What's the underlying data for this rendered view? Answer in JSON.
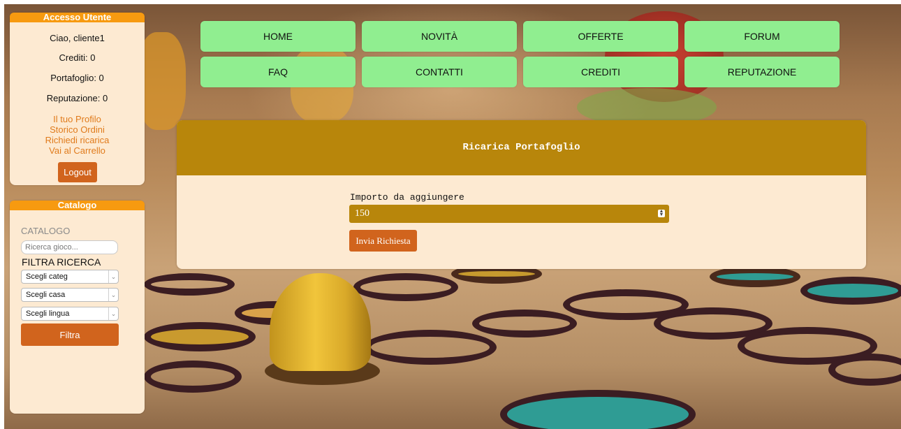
{
  "user_panel": {
    "header": "Accesso Utente",
    "greeting": "Ciao, cliente1",
    "credits": "Crediti: 0",
    "wallet": "Portafoglio: 0",
    "reputation": "Reputazione: 0",
    "links": [
      "Il tuo Profilo",
      "Storico Ordini",
      "Richiedi ricarica",
      "Vai al Carrello"
    ],
    "logout_label": "Logout"
  },
  "catalog_panel": {
    "header": "Catalogo",
    "label": "CATALOGO",
    "search_placeholder": "Ricerca gioco...",
    "filter_title": "FILTRA RICERCA",
    "selects": [
      "Scegli categ",
      "Scegli casa",
      "Scegli lingua"
    ],
    "filter_button": "Filtra"
  },
  "nav": {
    "items": [
      "HOME",
      "NOVITÀ",
      "OFFERTE",
      "FORUM",
      "FAQ",
      "CONTATTI",
      "CREDITI",
      "REPUTAZIONE"
    ]
  },
  "main": {
    "title": "Ricarica Portafoglio",
    "field_label": "Importo da aggiungere",
    "amount_value": "150",
    "submit_label": "Invia Richiesta"
  },
  "colors": {
    "accent_orange": "#f79a10",
    "button_orange": "#d1641d",
    "nav_green": "#90ee90",
    "card_gold": "#b8860b",
    "panel_bg": "#fdead2"
  }
}
